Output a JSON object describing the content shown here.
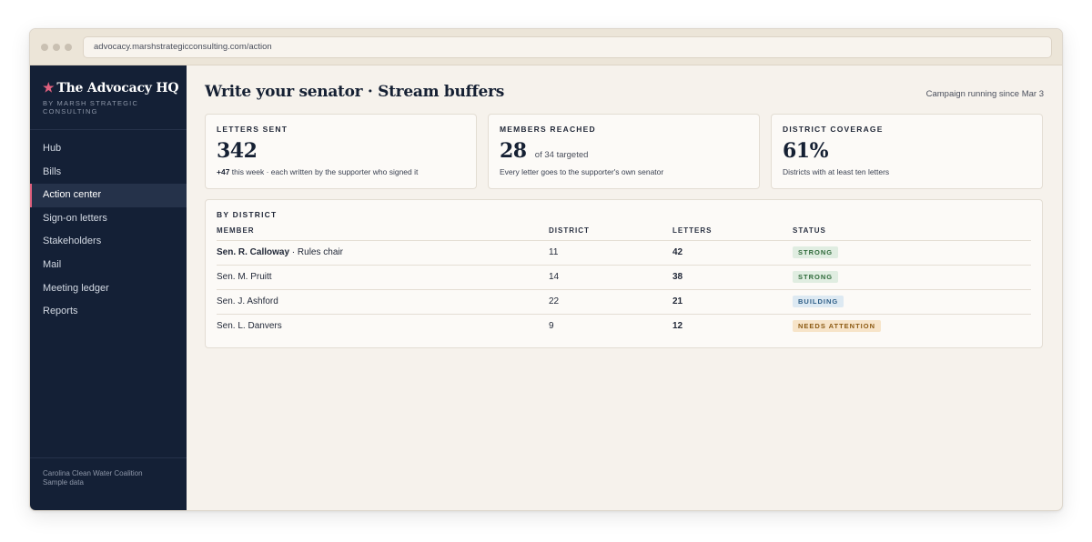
{
  "browser": {
    "url": "advocacy.marshstrategicconsulting.com/action"
  },
  "sidebar": {
    "brand_star": "★",
    "brand_title": "The Advocacy HQ",
    "brand_subtitle": "BY MARSH STRATEGIC CONSULTING",
    "items": [
      {
        "label": "Hub",
        "active": false
      },
      {
        "label": "Bills",
        "active": false
      },
      {
        "label": "Action center",
        "active": true
      },
      {
        "label": "Sign-on letters",
        "active": false
      },
      {
        "label": "Stakeholders",
        "active": false
      },
      {
        "label": "Mail",
        "active": false
      },
      {
        "label": "Meeting ledger",
        "active": false
      },
      {
        "label": "Reports",
        "active": false
      }
    ],
    "footer_line1": "Carolina Clean Water Coalition",
    "footer_line2": "Sample data"
  },
  "header": {
    "title": "Write your senator · Stream buffers",
    "running": "Campaign running since Mar 3"
  },
  "cards": [
    {
      "label": "LETTERS SENT",
      "value": "342",
      "value_suffix": "",
      "note_bold": "+47",
      "note": " this week · each written by the supporter who signed it"
    },
    {
      "label": "MEMBERS REACHED",
      "value": "28",
      "value_suffix": "of 34 targeted",
      "note_bold": "",
      "note": "Every letter goes to the supporter's own senator"
    },
    {
      "label": "DISTRICT COVERAGE",
      "value": "61%",
      "value_suffix": "",
      "note_bold": "",
      "note": "Districts with at least ten letters"
    }
  ],
  "district_table": {
    "title": "BY DISTRICT",
    "columns": [
      "MEMBER",
      "DISTRICT",
      "LETTERS",
      "STATUS"
    ],
    "rows": [
      {
        "member": "Sen. R. Calloway",
        "role": " · Rules chair",
        "district": "11",
        "letters": "42",
        "status": "STRONG"
      },
      {
        "member": "Sen. M. Pruitt",
        "role": "",
        "district": "14",
        "letters": "38",
        "status": "STRONG"
      },
      {
        "member": "Sen. J. Ashford",
        "role": "",
        "district": "22",
        "letters": "21",
        "status": "BUILDING"
      },
      {
        "member": "Sen. L. Danvers",
        "role": "",
        "district": "9",
        "letters": "12",
        "status": "NEEDS ATTENTION"
      }
    ]
  },
  "colors": {
    "sidebar_bg": "#142036",
    "accent": "#e0607e",
    "page_bg": "#f6f2ec",
    "badge_strong": "#e0ede1",
    "badge_building": "#dde9f2",
    "badge_needs": "#f7e4c9"
  }
}
